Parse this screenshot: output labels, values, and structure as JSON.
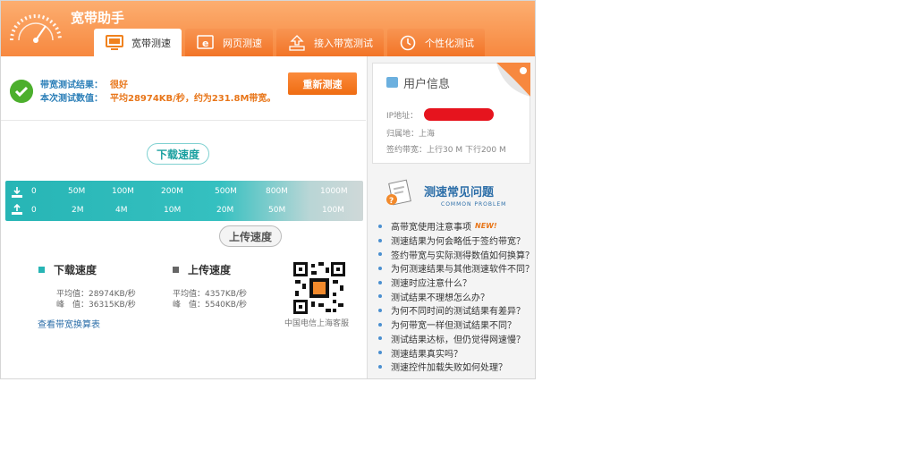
{
  "app": {
    "title": "宽带助手"
  },
  "tabs": [
    {
      "label": "宽带测速",
      "icon": "monitor-icon",
      "active": true
    },
    {
      "label": "网页测速",
      "icon": "ie-browser-icon",
      "active": false
    },
    {
      "label": "接入带宽测试",
      "icon": "network-access-icon",
      "active": false
    },
    {
      "label": "个性化测试",
      "icon": "clock-icon",
      "active": false
    }
  ],
  "result": {
    "result_label": "带宽测试结果：",
    "result_value": "很好",
    "value_label": "本次测试数值：",
    "value_text": "平均28974KB/秒，约为231.8M带宽。"
  },
  "retest_label": "重新测速",
  "gauge": {
    "download_label": "下载速度",
    "upload_label": "上传速度",
    "download_ticks": [
      "0",
      "50M",
      "100M",
      "200M",
      "500M",
      "800M",
      "1000M"
    ],
    "upload_ticks": [
      "0",
      "2M",
      "4M",
      "10M",
      "20M",
      "50M",
      "100M"
    ]
  },
  "stats": {
    "download": {
      "title": "下载速度",
      "avg": "平均值：28974KB/秒",
      "peak": "峰　值：36315KB/秒"
    },
    "upload": {
      "title": "上传速度",
      "avg": "平均值：4357KB/秒",
      "peak": "峰　值：5540KB/秒"
    },
    "convert_link": "查看带宽换算表",
    "qr_caption": "中国电信上海客服"
  },
  "user_info": {
    "title": "用户信息",
    "ip_label": "IP地址：",
    "region": "归属地：上海",
    "plan": "签约带宽：上行30 M 下行200 M"
  },
  "faq": {
    "title": "测速常见问题",
    "subtitle": "COMMON PROBLEM",
    "new_tag": "NEW!",
    "items": [
      "高带宽使用注意事项",
      "测速结果为何会略低于签约带宽？",
      "签约带宽与实际测得数值如何换算？",
      "为何测速结果与其他测速软件不同？",
      "测速时应注意什么？",
      "测试结果不理想怎么办？",
      "为何不同时间的测试结果有差异？",
      "为何带宽一样但测试结果不同？",
      "测试结果达标，但仍觉得网速慢？",
      "测速结果真实吗？",
      "测速控件加载失败如何处理？"
    ]
  },
  "colors": {
    "brand_orange": "#f7883f",
    "teal": "#27b5b5",
    "link_blue": "#2c6ea8"
  }
}
